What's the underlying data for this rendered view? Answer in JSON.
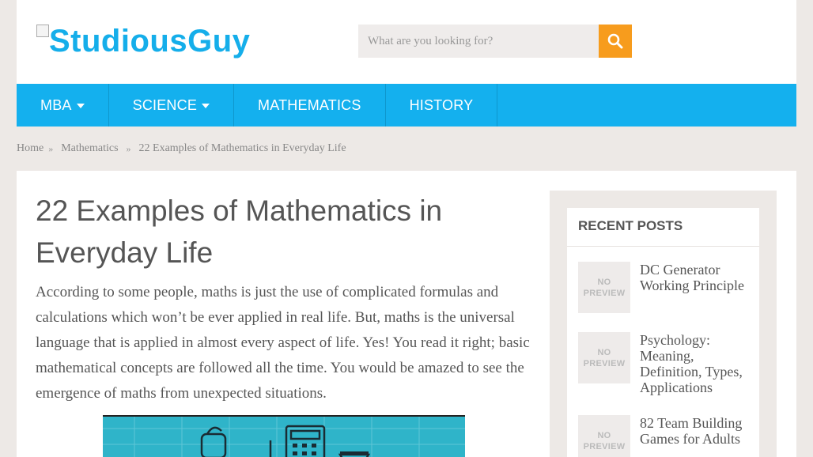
{
  "header": {
    "logo_text": "StudiousGuy",
    "search_placeholder": "What are you looking for?"
  },
  "nav": {
    "items": [
      {
        "label": "MBA",
        "has_dropdown": true
      },
      {
        "label": "SCIENCE",
        "has_dropdown": true
      },
      {
        "label": "MATHEMATICS",
        "has_dropdown": false
      },
      {
        "label": "HISTORY",
        "has_dropdown": false
      }
    ]
  },
  "breadcrumb": {
    "home": "Home",
    "category": "Mathematics",
    "current": "22 Examples of Mathematics in Everyday Life"
  },
  "article": {
    "title": "22 Examples of Mathematics in Everyday Life",
    "lead": "According to some people, maths is just the use of complicated formulas and calculations which won’t be ever applied in real life. But, maths is the universal language that is applied in almost every aspect of life. Yes! You read it right; basic mathematical concepts are followed all the time. You would be amazed to see the emergence of maths from unexpected situations."
  },
  "sidebar": {
    "widget_title": "RECENT POSTS",
    "thumb_line1": "NO",
    "thumb_line2": "PREVIEW",
    "posts": [
      {
        "title": "DC Generator Working Principle"
      },
      {
        "title": "Psychology: Meaning, Definition, Types, Applications"
      },
      {
        "title": "82 Team Building Games for Adults"
      }
    ]
  },
  "colors": {
    "brand_blue": "#14b0ee",
    "search_orange": "#f79c1d"
  }
}
